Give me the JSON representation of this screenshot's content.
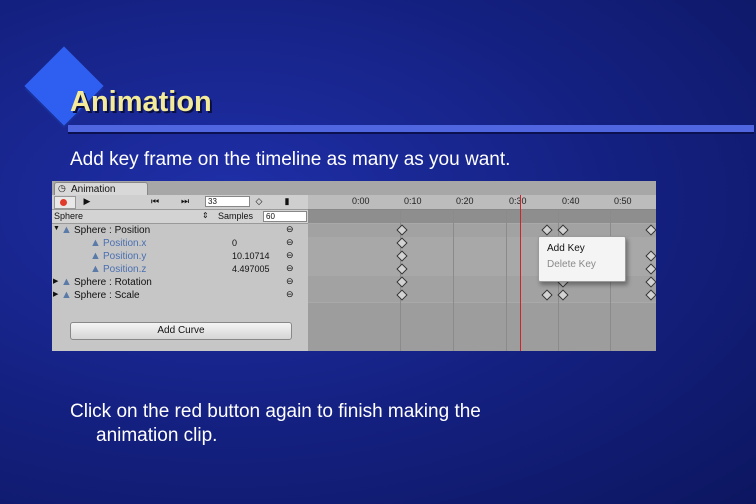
{
  "slide": {
    "title": "Animation",
    "bullet1": "Add key frame on the timeline as many as you want.",
    "bullet2_line1": "Click on the red button again to finish making the",
    "bullet2_line2": "animation clip."
  },
  "window": {
    "tab_label": "Animation",
    "frame_value": "33",
    "object_name": "Sphere",
    "samples_label": "Samples",
    "samples_value": "60",
    "add_curve_label": "Add Curve"
  },
  "properties": [
    {
      "name": "Sphere : Position",
      "value": "",
      "expanded": true
    },
    {
      "name": "Position.x",
      "value": "0"
    },
    {
      "name": "Position.y",
      "value": "10.10714"
    },
    {
      "name": "Position.z",
      "value": "4.497005"
    },
    {
      "name": "Sphere : Rotation",
      "value": "",
      "expanded": false
    },
    {
      "name": "Sphere : Scale",
      "value": "",
      "expanded": false
    }
  ],
  "timeline": {
    "ticks": [
      "0:00",
      "0:10",
      "0:20",
      "0:30",
      "0:40",
      "0:50"
    ]
  },
  "context_menu": {
    "add_key": "Add Key",
    "delete_key": "Delete Key"
  },
  "colors": {
    "record": "#e23a2a",
    "playhead": "#d0242a",
    "title": "#f3ea9a"
  }
}
